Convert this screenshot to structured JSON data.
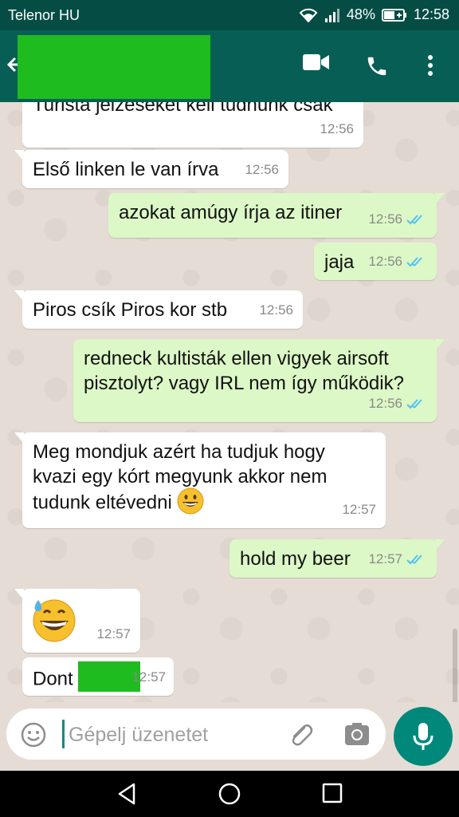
{
  "status_bar": {
    "carrier": "Telenor HU",
    "battery": "48%",
    "time": "12:58"
  },
  "app_bar": {
    "contact_name": ""
  },
  "messages": [
    {
      "dir": "in",
      "text": "Turista jelzéseket kell tudnunk csak",
      "time": "12:56"
    },
    {
      "dir": "in",
      "text": "Első linken le van írva",
      "time": "12:56"
    },
    {
      "dir": "out",
      "text": "azokat amúgy írja az itiner",
      "time": "12:56",
      "status": "read"
    },
    {
      "dir": "out",
      "text": "jaja",
      "time": "12:56",
      "status": "read"
    },
    {
      "dir": "in",
      "text": "Piros csík Piros kor stb",
      "time": "12:56"
    },
    {
      "dir": "out",
      "text_line1": "redneck kultisták ellen vigyek airsoft",
      "text_line2": "pisztolyt? vagy IRL nem így működik?",
      "time": "12:56",
      "status": "read"
    },
    {
      "dir": "in",
      "text_line1": "Meg mondjuk azért ha tudjuk hogy",
      "text_line2": "kvazi egy kórt megyunk akkor nem",
      "text_line3": "tudunk eltévedni",
      "emoji": "grinning-face",
      "time": "12:57"
    },
    {
      "dir": "out",
      "text": "hold my beer",
      "time": "12:57",
      "status": "read"
    },
    {
      "dir": "in",
      "emoji": "grinning-face-with-sweat",
      "time": "12:57"
    },
    {
      "dir": "in",
      "text": "Dont",
      "time": "12:57"
    }
  ],
  "composer": {
    "placeholder": "Gépelj üzenetet"
  },
  "colors": {
    "header": "#075e54",
    "statusbar": "#054d44",
    "outgoing": "#dcf8c6",
    "incoming": "#ffffff",
    "tick_read": "#4fc3f7",
    "fab": "#00897b"
  }
}
